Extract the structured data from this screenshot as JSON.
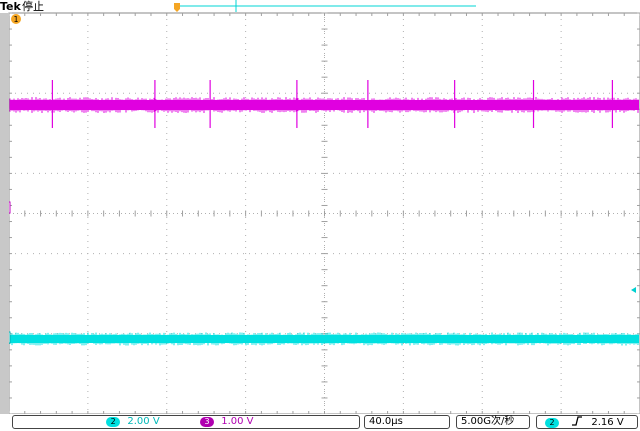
{
  "header": {
    "brand": "Tek",
    "status": "停止"
  },
  "channels": {
    "ch1": {
      "label": "1",
      "color": "#f5a623"
    },
    "ch2": {
      "label": "2",
      "color": "#00e0e0",
      "scale": "2.00 V"
    },
    "ch3": {
      "label": "3",
      "color": "#e000e0",
      "scale": "1.00 V"
    }
  },
  "footer": {
    "timebase": "40.0µs",
    "sample_rate": "5.00G次/秒",
    "trigger_channel": "2",
    "trigger_slope_icon": "rising-edge-icon",
    "trigger_level": "2.16 V"
  },
  "waveforms": {
    "magenta_spike_times_div": [
      0.55,
      1.85,
      2.55,
      3.65,
      4.55,
      5.65,
      6.65,
      7.65
    ]
  }
}
